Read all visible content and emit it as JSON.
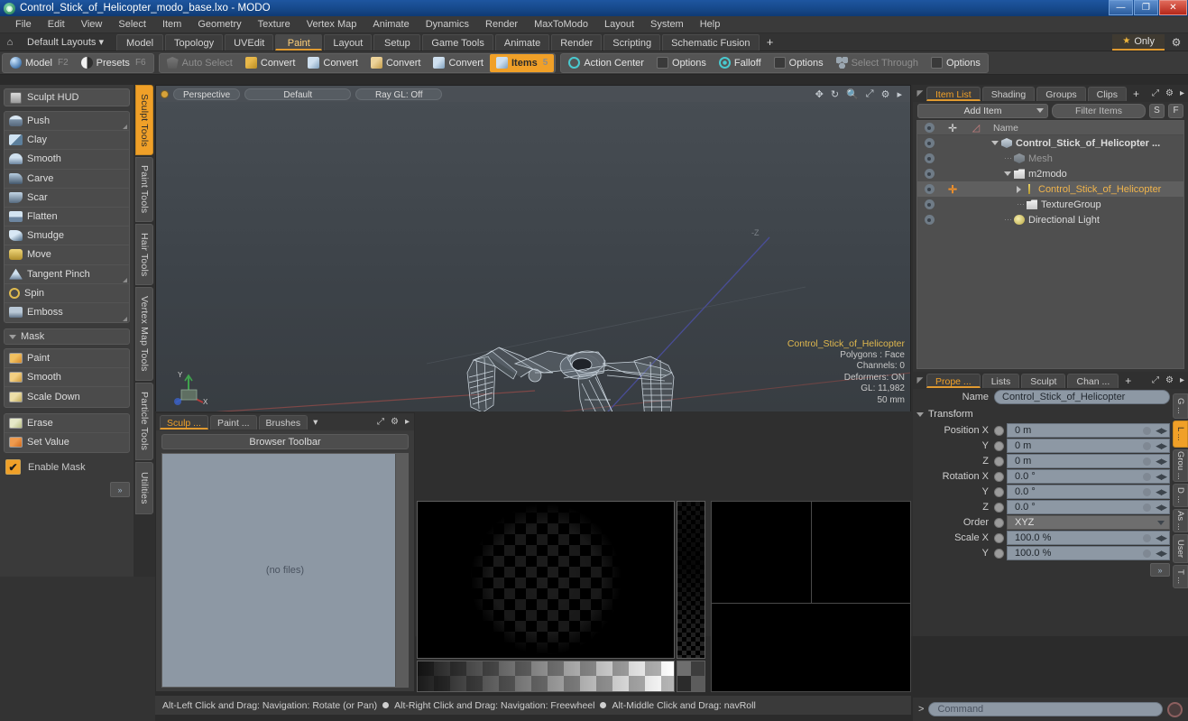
{
  "window": {
    "title": "Control_Stick_of_Helicopter_modo_base.lxo - MODO",
    "app_icon": "modo-logo-icon",
    "minimize": "—",
    "maximize": "❐",
    "close": "✕"
  },
  "menu": {
    "items": [
      "File",
      "Edit",
      "View",
      "Select",
      "Item",
      "Geometry",
      "Texture",
      "Vertex Map",
      "Animate",
      "Dynamics",
      "Render",
      "MaxToModo",
      "Layout",
      "System",
      "Help"
    ]
  },
  "layout_bar": {
    "home_icon": "home-icon",
    "layouts_label": "Default Layouts",
    "layouts_caret": "▾",
    "tabs": [
      {
        "label": "Model",
        "active": false
      },
      {
        "label": "Topology",
        "active": false
      },
      {
        "label": "UVEdit",
        "active": false
      },
      {
        "label": "Paint",
        "active": true
      },
      {
        "label": "Layout",
        "active": false
      },
      {
        "label": "Setup",
        "active": false
      },
      {
        "label": "Game Tools",
        "active": false
      },
      {
        "label": "Animate",
        "active": false
      },
      {
        "label": "Render",
        "active": false
      },
      {
        "label": "Scripting",
        "active": false
      },
      {
        "label": "Schematic Fusion",
        "active": false
      }
    ],
    "add_tab": "+",
    "only_label": "Only",
    "star_glyph": "★",
    "gear_glyph": "⚙"
  },
  "mode_bar": {
    "group1": [
      {
        "label": "Model",
        "fkey": "F2",
        "icon": "sphere-icon",
        "state": "normal"
      },
      {
        "label": "Presets",
        "fkey": "F6",
        "icon": "half-circle-icon",
        "state": "normal"
      }
    ],
    "group2": [
      {
        "label": "Auto Select",
        "icon": "shield-icon",
        "state": "dim"
      },
      {
        "label": "Convert",
        "icon": "convert-vertex-icon",
        "state": "normal"
      },
      {
        "label": "Convert",
        "icon": "convert-edge-icon",
        "state": "normal"
      },
      {
        "label": "Convert",
        "icon": "convert-poly-icon",
        "state": "normal"
      },
      {
        "label": "Convert",
        "icon": "convert-material-icon",
        "state": "normal"
      },
      {
        "label": "Items",
        "fkey": "5",
        "icon": "items-cube-icon",
        "state": "selected"
      }
    ],
    "group3": [
      {
        "label": "Action Center",
        "icon": "action-center-icon",
        "state": "normal"
      },
      {
        "label": "Options",
        "icon": "checkbox-icon",
        "state": "normal"
      },
      {
        "label": "Falloff",
        "icon": "falloff-icon",
        "state": "normal"
      },
      {
        "label": "Options",
        "icon": "checkbox-icon",
        "state": "normal"
      },
      {
        "label": "Select Through",
        "icon": "select-through-icon",
        "state": "dim"
      },
      {
        "label": "Options",
        "icon": "checkbox-icon",
        "state": "normal"
      }
    ]
  },
  "left_toolbox": {
    "hud_button": {
      "label": "Sculpt HUD",
      "icon": "hud-icon"
    },
    "sculpt_tools": [
      {
        "label": "Push",
        "icon": "push-icon",
        "corner": true
      },
      {
        "label": "Clay",
        "icon": "clay-icon",
        "corner": false
      },
      {
        "label": "Smooth",
        "icon": "smooth-icon",
        "corner": false
      },
      {
        "label": "Carve",
        "icon": "carve-icon",
        "corner": false
      },
      {
        "label": "Scar",
        "icon": "scar-icon",
        "corner": false
      },
      {
        "label": "Flatten",
        "icon": "flatten-icon",
        "corner": false
      },
      {
        "label": "Smudge",
        "icon": "smudge-icon",
        "corner": false
      },
      {
        "label": "Move",
        "icon": "move-icon",
        "corner": false
      },
      {
        "label": "Tangent Pinch",
        "icon": "tangent-pinch-icon",
        "corner": true
      },
      {
        "label": "Spin",
        "icon": "spin-icon",
        "corner": false
      },
      {
        "label": "Emboss",
        "icon": "emboss-icon",
        "corner": true
      }
    ],
    "mask_section": {
      "header": "Mask",
      "tools": [
        {
          "label": "Paint",
          "icon": "mask-paint-icon"
        },
        {
          "label": "Smooth",
          "icon": "mask-smooth-icon"
        },
        {
          "label": "Scale Down",
          "icon": "mask-scale-down-icon"
        }
      ],
      "tools2": [
        {
          "label": "Erase",
          "icon": "mask-erase-icon"
        },
        {
          "label": "Set Value",
          "icon": "mask-set-value-icon"
        }
      ],
      "enable_label": "Enable Mask",
      "enable_checked": true,
      "expand": "»"
    },
    "vertical_tabs": [
      {
        "label": "Sculpt Tools",
        "active": true
      },
      {
        "label": "Paint Tools",
        "active": false
      },
      {
        "label": "Hair Tools",
        "active": false
      },
      {
        "label": "Vertex Map Tools",
        "active": false
      },
      {
        "label": "Particle Tools",
        "active": false
      },
      {
        "label": "Utilities",
        "active": false
      }
    ]
  },
  "viewport": {
    "view_mode": "Perspective",
    "shading": "Default",
    "raygl": "Ray GL: Off",
    "icons": [
      "move-view-icon",
      "rotate-view-icon",
      "zoom-view-icon",
      "maximize-view-icon",
      "gear-icon",
      "chevron-right-icon"
    ],
    "hud": {
      "name": "Control_Stick_of_Helicopter",
      "polygons": "Polygons : Face",
      "channels": "Channels: 0",
      "deformers": "Deformers: ON",
      "gl": "GL: 11,982",
      "scale": "50 mm"
    },
    "axis_labels": {
      "x": "X",
      "y": "Y",
      "z": "Z",
      "neg_z": "-Z"
    }
  },
  "browser": {
    "tabs": [
      {
        "label": "Sculp ...",
        "active": true
      },
      {
        "label": "Paint ...",
        "active": false
      },
      {
        "label": "Brushes",
        "active": false
      }
    ],
    "dropdown_caret": "▾",
    "icons": [
      "maximize-icon",
      "gear-icon",
      "chevron-right-icon"
    ],
    "toolbar_label": "Browser Toolbar",
    "empty_text": "(no files)"
  },
  "status_bar": {
    "hint1": "Alt-Left Click and Drag: Navigation: Rotate (or Pan)",
    "hint2": "Alt-Right Click and Drag: Navigation: Freewheel",
    "hint3": "Alt-Middle Click and Drag: navRoll"
  },
  "item_list": {
    "tabs": [
      {
        "label": "Item List",
        "active": true
      },
      {
        "label": "Shading",
        "active": false
      },
      {
        "label": "Groups",
        "active": false
      },
      {
        "label": "Clips",
        "active": false
      }
    ],
    "add_tab": "+",
    "icons": [
      "maximize-icon",
      "gear-icon",
      "chevron-right-icon"
    ],
    "add_item_label": "Add Item",
    "filter_placeholder": "Filter Items",
    "btn_s": "S",
    "btn_f": "F",
    "columns": {
      "eye": "eye-icon",
      "lock": "transform-icon",
      "render": "render-icon",
      "name": "Name"
    },
    "rows": [
      {
        "label": "Control_Stick_of_Helicopter ...",
        "icon": "mesh-group-icon",
        "indent": 0,
        "expander": "down",
        "bold": true,
        "selected": false,
        "transform": false
      },
      {
        "label": "Mesh",
        "icon": "mesh-icon",
        "indent": 1,
        "expander": "none",
        "bold": false,
        "selected": false,
        "dim": true,
        "transform": false
      },
      {
        "label": "m2modo",
        "icon": "folder-icon",
        "indent": 1,
        "expander": "down",
        "bold": false,
        "selected": false,
        "transform": false
      },
      {
        "label": "Control_Stick_of_Helicopter",
        "icon": "locator-icon",
        "indent": 2,
        "expander": "right",
        "bold": false,
        "selected": true,
        "transform": true
      },
      {
        "label": "TextureGroup",
        "icon": "folder-icon",
        "indent": 2,
        "expander": "none",
        "bold": false,
        "selected": false,
        "transform": false
      },
      {
        "label": "Directional Light",
        "icon": "light-icon",
        "indent": 1,
        "expander": "none",
        "bold": false,
        "selected": false,
        "transform": false
      }
    ]
  },
  "properties": {
    "tabs": [
      {
        "label": "Prope ...",
        "active": true
      },
      {
        "label": "Lists",
        "active": false
      },
      {
        "label": "Sculpt",
        "active": false
      },
      {
        "label": "Chan ...",
        "active": false
      }
    ],
    "add_tab": "+",
    "icons": [
      "maximize-icon",
      "gear-icon",
      "chevron-right-icon"
    ],
    "name_label": "Name",
    "name_value": "Control_Stick_of_Helicopter",
    "transform_header": "Transform",
    "fields": [
      {
        "label": "Position X",
        "value": "0 m",
        "type": "num"
      },
      {
        "label": "Y",
        "value": "0 m",
        "type": "num"
      },
      {
        "label": "Z",
        "value": "0 m",
        "type": "num"
      },
      {
        "label": "Rotation X",
        "value": "0.0 °",
        "type": "num"
      },
      {
        "label": "Y",
        "value": "0.0 °",
        "type": "num"
      },
      {
        "label": "Z",
        "value": "0.0 °",
        "type": "num"
      },
      {
        "label": "Order",
        "value": "XYZ",
        "type": "select"
      },
      {
        "label": "Scale X",
        "value": "100.0 %",
        "type": "num"
      },
      {
        "label": "Y",
        "value": "100.0 %",
        "type": "num"
      }
    ],
    "expand": "»",
    "vertical_tabs": [
      {
        "label": "G ...",
        "active": false
      },
      {
        "label": "L ...",
        "active": true
      },
      {
        "label": "Grou ...",
        "active": false
      },
      {
        "label": "D ...",
        "active": false
      },
      {
        "label": "As ...",
        "active": false
      },
      {
        "label": "User",
        "active": false
      },
      {
        "label": "T ...",
        "active": false
      }
    ]
  },
  "command_bar": {
    "prompt": ">",
    "placeholder": "Command",
    "record_icon": "record-icon"
  },
  "colors": {
    "accent_orange": "#f0a028",
    "title_blue": "#174a8c",
    "panel_bg": "#3a3a3a",
    "viewport_bg": "#3d4349",
    "field_blue": "#8d98a4"
  }
}
